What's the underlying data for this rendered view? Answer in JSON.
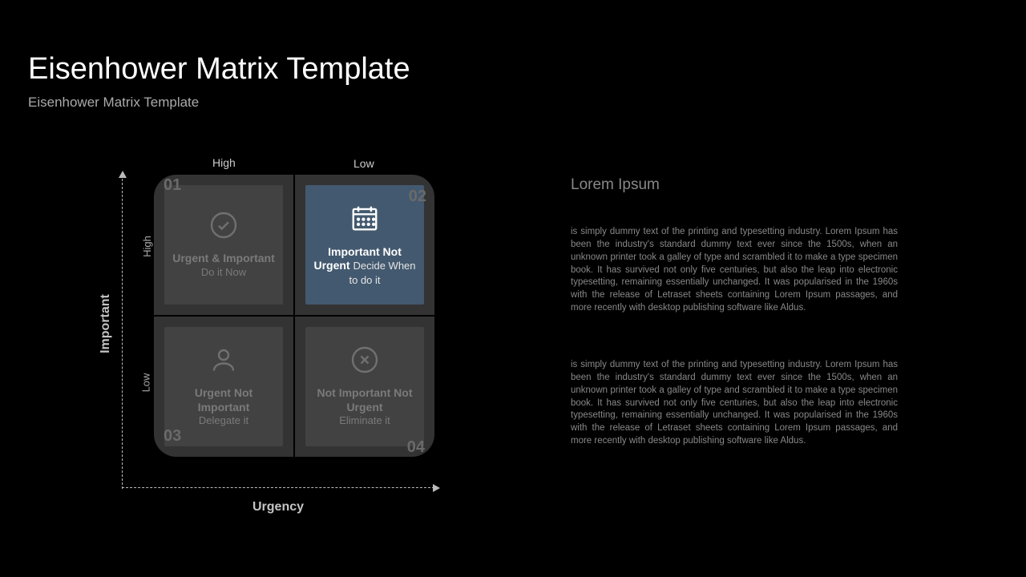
{
  "title": "Eisenhower Matrix Template",
  "subtitle": "Eisenhower Matrix Template",
  "axis": {
    "important": "Important",
    "urgency": "Urgency",
    "y_high": "High",
    "y_low": "Low",
    "x_high": "High",
    "x_low": "Low"
  },
  "quads": {
    "q1": {
      "num": "01",
      "title": "Urgent & Important",
      "sub": "Do it Now"
    },
    "q2": {
      "num": "02",
      "title_a": "Important Not Urgent ",
      "sub": "Decide When to do it"
    },
    "q3": {
      "num": "03",
      "title": "Urgent Not Important",
      "sub": "Delegate it"
    },
    "q4": {
      "num": "04",
      "title": "Not Important Not Urgent",
      "sub": "Eliminate it"
    }
  },
  "right": {
    "heading": "Lorem Ipsum",
    "p1": "is simply dummy text of the printing and typesetting industry. Lorem Ipsum has been the industry's standard dummy text ever since the 1500s, when an unknown printer took a galley of type and scrambled it to make a type specimen book. It has survived not only five centuries, but also the leap into electronic typesetting, remaining essentially unchanged. It was popularised in the 1960s with the release of Letraset sheets containing Lorem Ipsum passages, and more recently with desktop publishing software like Aldus.",
    "p2": "is simply dummy text of the printing and typesetting industry. Lorem Ipsum has been the industry's standard dummy text ever since the 1500s, when an unknown printer took a galley of type and scrambled it to make a type specimen book. It has survived not only five centuries, but also the leap into electronic typesetting, remaining essentially unchanged. It was popularised in the 1960s with the release of Letraset sheets containing Lorem Ipsum passages, and more recently with desktop publishing software like Aldus."
  }
}
